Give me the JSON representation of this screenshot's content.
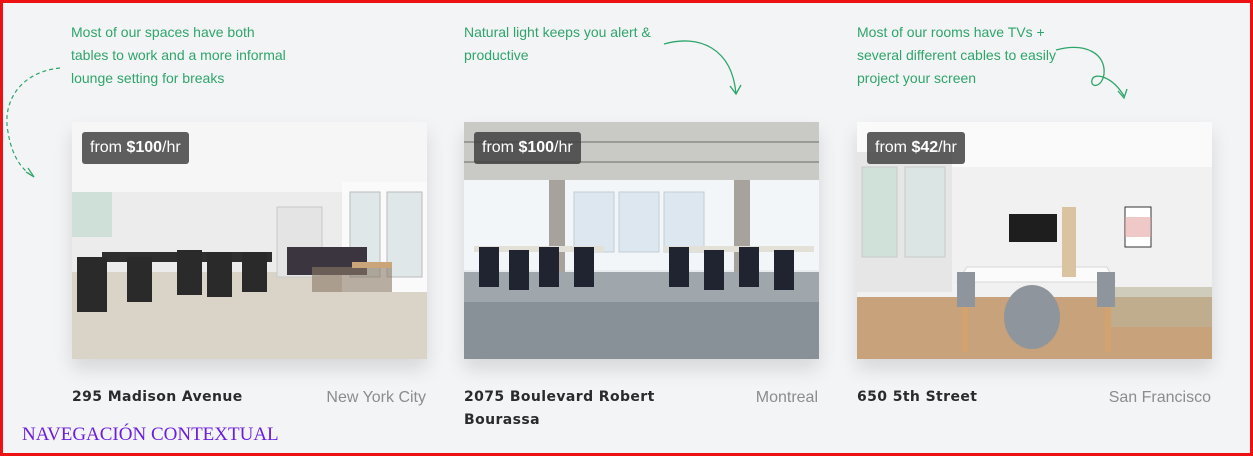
{
  "notes": [
    "Most of our spaces have both tables to work and a more informal lounge setting for breaks",
    "Natural light keeps you alert & productive",
    "Most of our rooms have TVs + several different cables to easily project your screen"
  ],
  "listings": [
    {
      "price_prefix": "from ",
      "price": "$100",
      "price_unit": "/hr",
      "address": "295 Madison Avenue",
      "city": "New York City"
    },
    {
      "price_prefix": "from ",
      "price": "$100",
      "price_unit": "/hr",
      "address": "2075 Boulevard Robert Bourassa",
      "city": "Montreal"
    },
    {
      "price_prefix": "from ",
      "price": "$42",
      "price_unit": "/hr",
      "address": "650 5th Street",
      "city": "San Francisco"
    }
  ],
  "overlay_label": "NAVEGACIÓN CONTEXTUAL",
  "colors": {
    "accent_green": "#2fa56b",
    "frame_red": "#ee1111",
    "overlay_purple": "#6a1ee0"
  }
}
